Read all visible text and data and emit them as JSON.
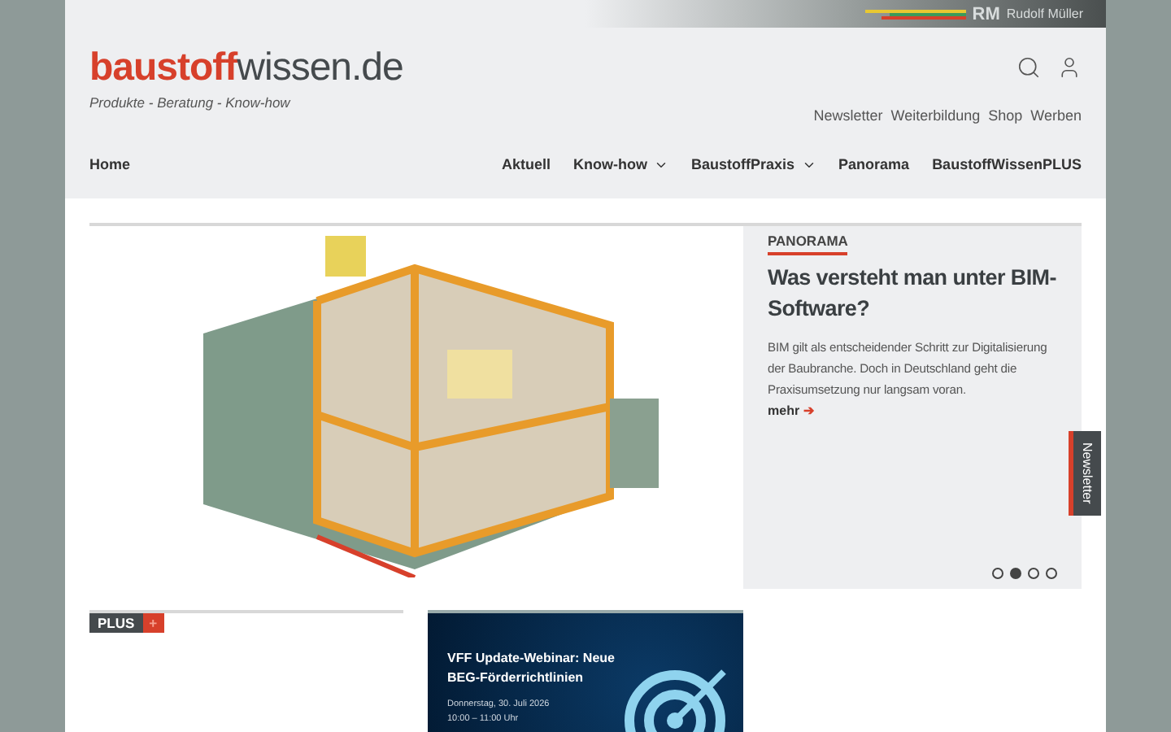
{
  "top_bar": {
    "publisher": "RM",
    "publisher_name": "Rudolf Müller"
  },
  "logo": {
    "brand_first": "baustoff",
    "brand_second": "wissen.de",
    "tagline": "Produkte - Beratung - Know-how"
  },
  "service_links": [
    "Newsletter",
    "Weiterbildung",
    "Shop",
    "Werben"
  ],
  "nav": {
    "home": "Home",
    "items": [
      {
        "label": "Aktuell",
        "dropdown": false
      },
      {
        "label": "Know-how",
        "dropdown": true
      },
      {
        "label": "BaustoffPraxis",
        "dropdown": true
      },
      {
        "label": "Panorama",
        "dropdown": false
      },
      {
        "label": "BaustoffWissenPLUS",
        "dropdown": false
      }
    ]
  },
  "hero": {
    "category": "PANORAMA",
    "title": "Was versteht man unter BIM-Software?",
    "text": "BIM gilt als entscheidender Schritt zur Digitalisierung der Baubranche. Doch in Deutschland geht die Praxisumsetzung nur langsam voran.",
    "more": "mehr",
    "more_arrow": "➔",
    "slides": [
      {
        "selected": false
      },
      {
        "selected": true
      },
      {
        "selected": false
      },
      {
        "selected": false
      }
    ]
  },
  "newsletter_tab": "Newsletter",
  "plus": {
    "label": "PLUS",
    "icon": "+"
  },
  "ad": {
    "title": "VFF Update-Webinar: Neue BEG-Förderrichtlinien",
    "date": "Donnerstag, 30. Juli 2026",
    "time": "10:00 – 11:00 Uhr"
  }
}
